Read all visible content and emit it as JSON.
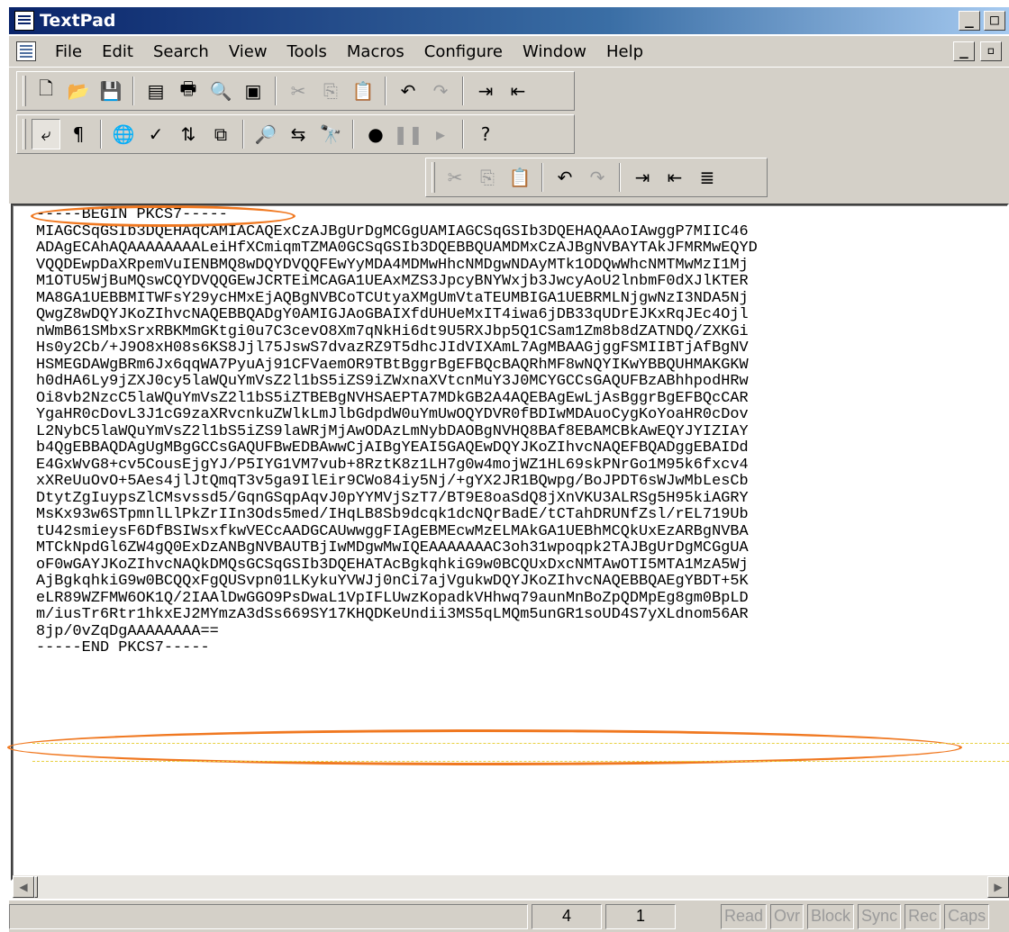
{
  "window": {
    "title": "TextPad"
  },
  "menu": [
    {
      "label": "File",
      "name": "menu-file"
    },
    {
      "label": "Edit",
      "name": "menu-edit"
    },
    {
      "label": "Search",
      "name": "menu-search"
    },
    {
      "label": "View",
      "name": "menu-view"
    },
    {
      "label": "Tools",
      "name": "menu-tools"
    },
    {
      "label": "Macros",
      "name": "menu-macros"
    },
    {
      "label": "Configure",
      "name": "menu-configure"
    },
    {
      "label": "Window",
      "name": "menu-window"
    },
    {
      "label": "Help",
      "name": "menu-help"
    }
  ],
  "toolbar1": [
    "new-file-icon",
    "open-folder-icon",
    "save-icon",
    "|",
    "document-properties-icon",
    "print-icon",
    "print-preview-icon",
    "manage-files-icon",
    "|",
    "cut-icon",
    "copy-icon",
    "paste-icon",
    "|",
    "undo-icon",
    "redo-icon",
    "|",
    "indent-icon",
    "outdent-icon"
  ],
  "toolbar2": [
    "word-wrap-icon",
    "show-visible-spaces-icon",
    "|",
    "web-browser-icon",
    "spell-check-icon",
    "sort-icon",
    "compare-icon",
    "|",
    "find-icon",
    "replace-icon",
    "find-in-files-icon",
    "|",
    "record-macro-icon",
    "pause-macro-icon",
    "play-macro-icon",
    "|",
    "context-help-icon"
  ],
  "toolbar3": [
    "cut-icon",
    "copy-icon",
    "paste-icon",
    "|",
    "undo-icon",
    "redo-icon",
    "|",
    "indent-icon",
    "outdent-icon",
    "block-format-icon"
  ],
  "editor": {
    "lines": [
      "-----BEGIN PKCS7-----",
      "MIAGCSqGSIb3DQEHAqCAMIACAQExCzAJBgUrDgMCGgUAMIAGCSqGSIb3DQEHAQAAoIAwggP7MIIC46",
      "ADAgECAhAQAAAAAAAALeiHfXCmiqmTZMA0GCSqGSIb3DQEBBQUAMDMxCzAJBgNVBAYTAkJFMRMwEQYD",
      "VQQDEwpDaXRpemVuIENBMQ8wDQYDVQQFEwYyMDA4MDMwHhcNMDgwNDAyMTk1ODQwWhcNMTMwMzI1Mj",
      "M1OTU5WjBuMQswCQYDVQQGEwJCRTEiMCAGA1UEAxMZS3JpcyBNYWxjb3JwcyAoU2lnbmF0dXJlKTER",
      "MA8GA1UEBBMITWFsY29ycHMxEjAQBgNVBCoTCUtyaXMgUmVtaTEUMBIGA1UEBRMLNjgwNzI3NDA5Nj",
      "QwgZ8wDQYJKoZIhvcNAQEBBQADgY0AMIGJAoGBAIXfdUHUeMxIT4iwa6jDB33qUDrEJKxRqJEc4Ojl",
      "nWmB61SMbxSrxRBKMmGKtgi0u7C3cevO8Xm7qNkHi6dt9U5RXJbp5Q1CSam1Zm8b8dZATNDQ/ZXKGi",
      "Hs0y2Cb/+J9O8xH08s6KS8Jjl75JswS7dvazRZ9T5dhcJIdVIXAmL7AgMBAAGjggFSMIIBTjAfBgNV",
      "HSMEGDAWgBRm6Jx6qqWA7PyuAj91CFVaemOR9TBtBggrBgEFBQcBAQRhMF8wNQYIKwYBBQUHMAKGKW",
      "h0dHA6Ly9jZXJ0cy5laWQuYmVsZ2l1bS5iZS9iZWxnaXVtcnMuY3J0MCYGCCsGAQUFBzABhhpodHRw",
      "Oi8vb2NzcC5laWQuYmVsZ2l1bS5iZTBEBgNVHSAEPTA7MDkGB2A4AQEBAgEwLjAsBggrBgEFBQcCAR",
      "YgaHR0cDovL3J1cG9zaXRvcnkuZWlkLmJlbGdpdW0uYmUwOQYDVR0fBDIwMDAuoCygKoYoaHR0cDov",
      "L2NybC5laWQuYmVsZ2l1bS5iZS9laWRjMjAwODAzLmNybDAOBgNVHQ8BAf8EBAMCBkAwEQYJYIZIAY",
      "b4QgEBBAQDAgUgMBgGCCsGAQUFBwEDBAwwCjAIBgYEAI5GAQEwDQYJKoZIhvcNAQEFBQADggEBAIDd",
      "E4GxWvG8+cv5CousEjgYJ/P5IYG1VM7vub+8RztK8z1LH7g0w4mojWZ1HL69skPNrGo1M95k6fxcv4",
      "xXReUuOvO+5Aes4jlJtQmqT3v5ga9IlEir9CWo84iy5Nj/+gYX2JR1BQwpg/BoJPDT6sWJwMbLesCb",
      "DtytZgIuypsZlCMsvssd5/GqnGSqpAqvJ0pYYMVjSzT7/BT9E8oaSdQ8jXnVKU3ALRSg5H95kiAGRY",
      "MsKx93w6STpmnlLlPkZrIIn3Ods5med/IHqLB8Sb9dcqk1dcNQrBadE/tCTahDRUNfZsl/rEL719Ub",
      "tU42smieysF6DfBSIWsxfkwVECcAADGCAUwwggFIAgEBMEcwMzELMAkGA1UEBhMCQkUxEzARBgNVBA",
      "MTCkNpdGl6ZW4gQ0ExDzANBgNVBAUTBjIwMDgwMwIQEAAAAAAAC3oh31wpoqpk2TAJBgUrDgMCGgUA",
      "oF0wGAYJKoZIhvcNAQkDMQsGCSqGSIb3DQEHATAcBgkqhkiG9w0BCQUxDxcNMTAwOTI5MTA1MzA5Wj",
      "AjBgkqhkiG9w0BCQQxFgQUSvpn01LKykuYVWJj0nCi7ajVgukwDQYJKoZIhvcNAQEBBQAEgYBDT+5K",
      "eLR89WZFMW6OK1Q/2IAAlDwGGO9PsDwaL1VpIFLUwzKopadkVHhwq79aunMnBoZpQDMpEg8gm0BpLD",
      "m/iusTr6Rtr1hkxEJ2MYmzA3dSs669SY17KHQDKeUndii3MS5qLMQm5unGR1soUD4S7yXLdnom56AR",
      "8jp/0vZqDgAAAAAAAA==",
      "-----END PKCS7-----"
    ]
  },
  "statusbar": {
    "line": "4",
    "column": "1",
    "flags": [
      "Read",
      "Ovr",
      "Block",
      "Sync",
      "Rec",
      "Caps"
    ]
  }
}
